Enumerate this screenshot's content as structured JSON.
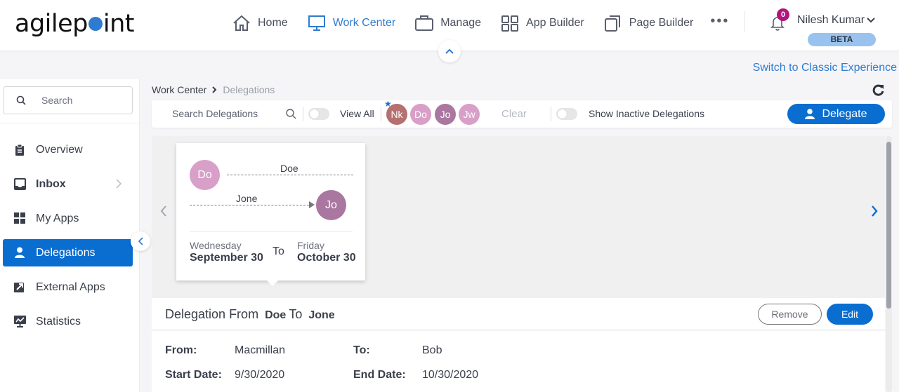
{
  "brand": {
    "logo_text_a": "agilep",
    "logo_text_b": "int"
  },
  "nav": {
    "items": [
      {
        "label": "Home",
        "icon": "home-icon"
      },
      {
        "label": "Work Center",
        "icon": "monitor-icon",
        "active": true
      },
      {
        "label": "Manage",
        "icon": "briefcase-icon"
      },
      {
        "label": "App Builder",
        "icon": "grid-icon"
      },
      {
        "label": "Page Builder",
        "icon": "copy-pages-icon"
      }
    ],
    "more": "•••"
  },
  "user": {
    "notifications": "0",
    "name": "Nilesh Kumar",
    "badge": "BETA"
  },
  "switch_link": "Switch to Classic Experience",
  "sidebar": {
    "search_placeholder": "Search",
    "items": [
      {
        "label": "Overview",
        "icon": "clipboard-icon"
      },
      {
        "label": "Inbox",
        "icon": "inbox-icon",
        "has_submenu": true
      },
      {
        "label": "My Apps",
        "icon": "apps-grid-icon"
      },
      {
        "label": "Delegations",
        "icon": "person-icon",
        "active": true
      },
      {
        "label": "External Apps",
        "icon": "external-link-icon"
      },
      {
        "label": "Statistics",
        "icon": "chart-monitor-icon"
      }
    ]
  },
  "breadcrumb": {
    "root": "Work Center",
    "separator": "›",
    "current": "Delegations"
  },
  "toolbar": {
    "search_placeholder": "Search Delegations",
    "view_all_label": "View All",
    "view_all_on": false,
    "avatars": [
      {
        "initials": "Nk",
        "color": "#b5706f",
        "starred": true
      },
      {
        "initials": "Do",
        "color": "#d89fc8"
      },
      {
        "initials": "Jo",
        "color": "#a9779f"
      },
      {
        "initials": "Jw",
        "color": "#d89fc8"
      }
    ],
    "star": "★",
    "clear_label": "Clear",
    "inactive_label": "Show Inactive Delegations",
    "inactive_on": false,
    "delegate_label": "Delegate"
  },
  "card": {
    "from_initials": "Do",
    "from_color": "#d89fc8",
    "from_name": "Doe",
    "to_initials": "Jo",
    "to_color": "#a9779f",
    "to_name": "Jone",
    "start_day": "Wednesday",
    "start_date": "September 30",
    "to_word": "To",
    "end_day": "Friday",
    "end_date": "October 30"
  },
  "detail": {
    "title_prefix": "Delegation From",
    "from": "Doe",
    "to_word": "To",
    "to": "Jone",
    "remove_label": "Remove",
    "edit_label": "Edit",
    "fields": {
      "from_label": "From:",
      "from_value": "Macmillan",
      "to_label": "To:",
      "to_value": "Bob",
      "start_label": "Start Date:",
      "start_value": "9/30/2020",
      "end_label": "End Date:",
      "end_value": "10/30/2020"
    }
  },
  "colors": {
    "accent": "#0a6ed1",
    "link": "#2f7bd1",
    "badge": "#b0167d",
    "beta": "#99c3ee"
  }
}
